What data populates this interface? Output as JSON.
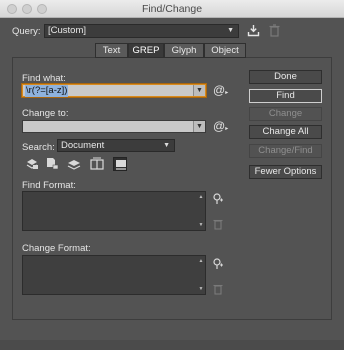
{
  "window": {
    "title": "Find/Change"
  },
  "query": {
    "label": "Query:",
    "value": "[Custom]"
  },
  "tabs": [
    {
      "label": "Text",
      "active": false
    },
    {
      "label": "GREP",
      "active": true
    },
    {
      "label": "Glyph",
      "active": false
    },
    {
      "label": "Object",
      "active": false
    }
  ],
  "find": {
    "label": "Find what:",
    "value": "\\r(?=[a-z])"
  },
  "change": {
    "label": "Change to:",
    "value": ""
  },
  "search": {
    "label": "Search:",
    "value": "Document"
  },
  "find_format": {
    "label": "Find Format:"
  },
  "change_format": {
    "label": "Change Format:"
  },
  "buttons": {
    "done": "Done",
    "find": "Find",
    "change": "Change",
    "change_all": "Change All",
    "change_find": "Change/Find",
    "fewer_options": "Fewer Options"
  },
  "colors": {
    "accent_focus": "#d88b1e",
    "panel_bg": "#535353",
    "selection": "#8fb2dc"
  },
  "icons": {
    "save_query": "save-query-icon",
    "delete_query": "trash-icon",
    "special_chars": "at-sign-icon",
    "search_options": [
      "include-locked-layers-icon",
      "include-locked-stories-icon",
      "include-hidden-layers-icon",
      "include-master-pages-icon",
      "include-footnotes-icon"
    ]
  }
}
